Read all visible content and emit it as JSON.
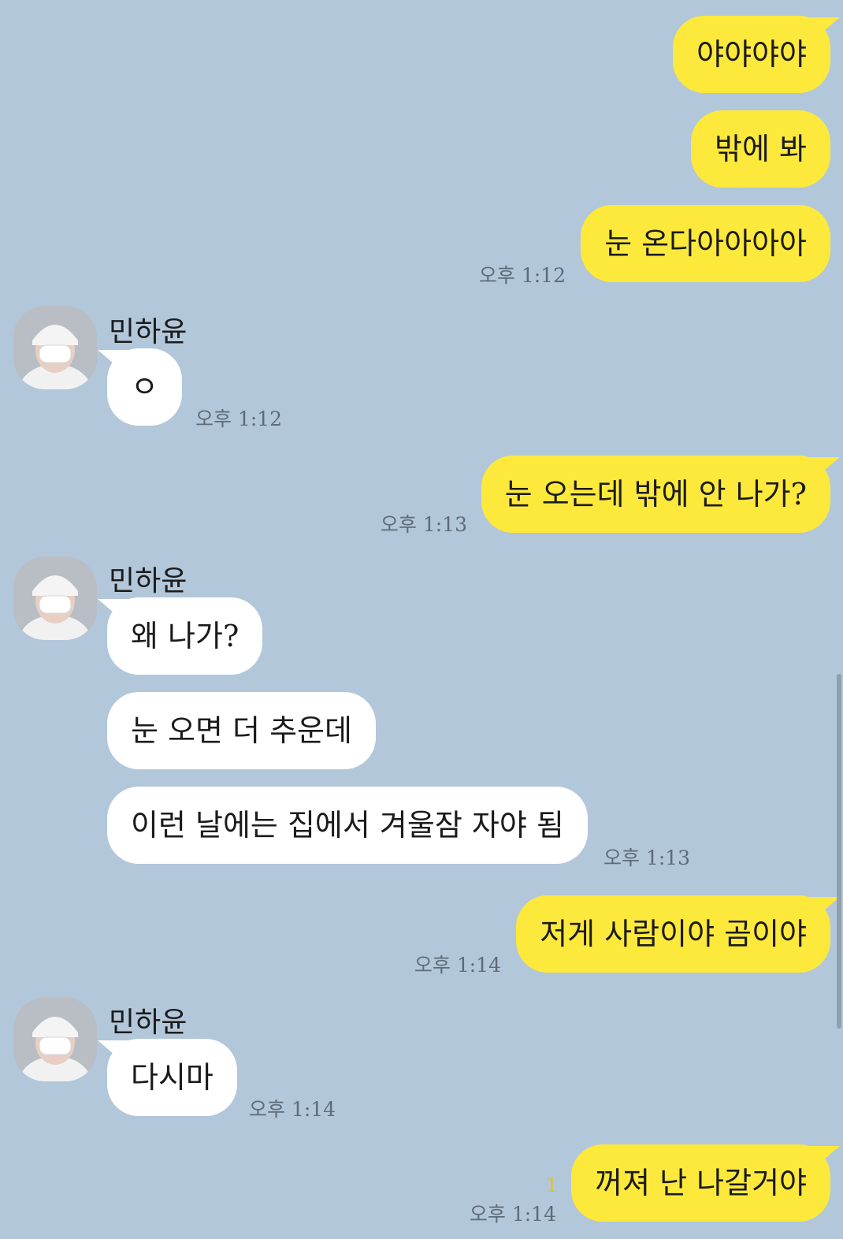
{
  "chat": {
    "partner_name": "민하윤",
    "colors": {
      "background": "#b2c7da",
      "my_bubble": "#fde93c",
      "their_bubble": "#ffffff",
      "unread": "#e6c21d"
    },
    "messages": [
      {
        "from": "me",
        "text": "야야야야"
      },
      {
        "from": "me",
        "text": "밖에 봐"
      },
      {
        "from": "me",
        "text": "눈 온다아아아아",
        "time": "오후 1:12"
      },
      {
        "from": "them",
        "text": "ㅇ",
        "time": "오후 1:12"
      },
      {
        "from": "me",
        "text": "눈 오는데 밖에 안 나가?",
        "time": "오후 1:13"
      },
      {
        "from": "them",
        "text": "왜 나가?"
      },
      {
        "from": "them",
        "text": "눈 오면 더 추운데"
      },
      {
        "from": "them",
        "text": "이런 날에는 집에서 겨울잠 자야 됨",
        "time": "오후 1:13"
      },
      {
        "from": "me",
        "text": "저게 사람이야 곰이야",
        "time": "오후 1:14"
      },
      {
        "from": "them",
        "text": "다시마",
        "time": "오후 1:14"
      },
      {
        "from": "me",
        "text": "꺼져 난 나갈거야",
        "time": "오후 1:14",
        "unread": "1"
      }
    ]
  }
}
